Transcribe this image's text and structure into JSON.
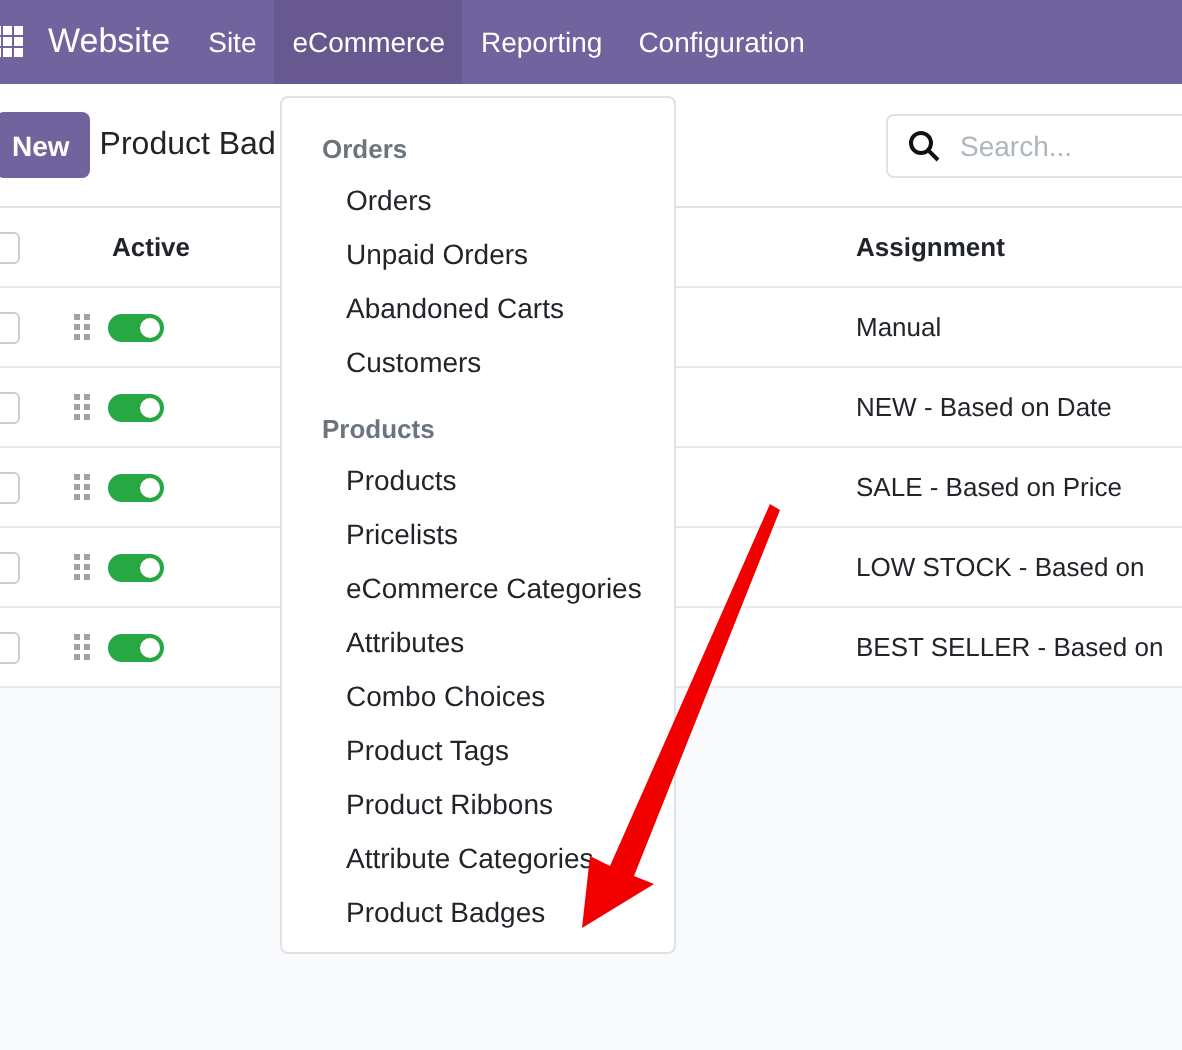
{
  "navbar": {
    "app_name": "Website",
    "menus": [
      {
        "label": "Site",
        "selected": false
      },
      {
        "label": "eCommerce",
        "selected": true
      },
      {
        "label": "Reporting",
        "selected": false
      },
      {
        "label": "Configuration",
        "selected": false
      }
    ]
  },
  "control_panel": {
    "new_button": "New",
    "breadcrumb": "Product Bad",
    "search": {
      "placeholder": "Search..."
    }
  },
  "table": {
    "columns": [
      "Active",
      "Assignment"
    ],
    "select_all_checked": false,
    "rows": [
      {
        "checked": false,
        "active": true,
        "assignment": "Manual"
      },
      {
        "checked": false,
        "active": true,
        "assignment": "NEW - Based on Date"
      },
      {
        "checked": false,
        "active": true,
        "assignment": "SALE - Based on Price"
      },
      {
        "checked": false,
        "active": true,
        "assignment": "LOW STOCK - Based on"
      },
      {
        "checked": false,
        "active": true,
        "assignment": "BEST SELLER - Based on"
      }
    ]
  },
  "dropdown": {
    "sections": [
      {
        "header": "Orders",
        "items": [
          "Orders",
          "Unpaid Orders",
          "Abandoned Carts",
          "Customers"
        ]
      },
      {
        "header": "Products",
        "items": [
          "Products",
          "Pricelists",
          "eCommerce Categories",
          "Attributes",
          "Combo Choices",
          "Product Tags",
          "Product Ribbons",
          "Attribute Categories",
          "Product Badges"
        ]
      }
    ]
  }
}
